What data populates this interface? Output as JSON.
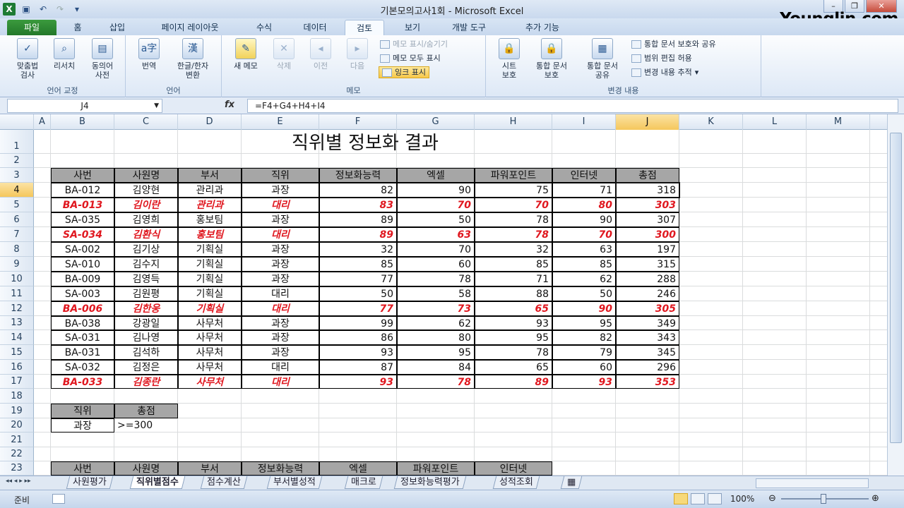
{
  "window": {
    "title": "기본모의고사1회 - Microsoft Excel",
    "brand": "Younglin.com"
  },
  "tabs": [
    "파일",
    "홈",
    "삽입",
    "페이지 레이아웃",
    "수식",
    "데이터",
    "검토",
    "보기",
    "개발 도구",
    "추가 기능"
  ],
  "active_tab": "검토",
  "ribbon": {
    "groups": {
      "lang": "언어 교정",
      "language": "언어",
      "memo": "메모",
      "changes": "변경 내용"
    },
    "spell": "맞춤법\n검사",
    "research": "리서치",
    "thesaurus": "동의어\n사전",
    "translate": "번역",
    "hanja": "한글/한자\n변환",
    "new_memo": "새 메모",
    "delete": "삭제",
    "prev": "이전",
    "next": "다음",
    "show_hide_memo": "메모 표시/숨기기",
    "show_all_memo": "메모 모두 표시",
    "ink": "잉크 표시",
    "protect_sheet": "시트\n보호",
    "protect_wb": "통합 문서\n보호",
    "share_wb": "통합 문서\n공유",
    "protect_share": "통합 문서 보호와 공유",
    "allow_edit": "범위 편집 허용",
    "track": "변경 내용 추적"
  },
  "formula_bar": {
    "name_box": "J4",
    "formula": "=F4+G4+H4+I4"
  },
  "columns": [
    "A",
    "B",
    "C",
    "D",
    "E",
    "F",
    "G",
    "H",
    "I",
    "J",
    "K",
    "L",
    "M"
  ],
  "selected_column": "J",
  "selected_row": 4,
  "rows": [
    "1",
    "2",
    "3",
    "4",
    "5",
    "6",
    "7",
    "8",
    "9",
    "10",
    "11",
    "12",
    "13",
    "14",
    "15",
    "16",
    "17",
    "18",
    "19",
    "20",
    "21",
    "22",
    "23"
  ],
  "sheet_title": "직위별 정보화 결과",
  "table_headers": [
    "사번",
    "사원명",
    "부서",
    "직위",
    "정보화능력",
    "엑셀",
    "파워포인트",
    "인터넷",
    "총점"
  ],
  "table_rows": [
    {
      "id": "BA-012",
      "name": "김양현",
      "dept": "관리과",
      "pos": "과장",
      "info": "82",
      "excel": "90",
      "ppt": "75",
      "net": "71",
      "total": "318",
      "hl": false
    },
    {
      "id": "BA-013",
      "name": "김이란",
      "dept": "관리과",
      "pos": "대리",
      "info": "83",
      "excel": "70",
      "ppt": "70",
      "net": "80",
      "total": "303",
      "hl": true
    },
    {
      "id": "SA-035",
      "name": "김영희",
      "dept": "홍보팀",
      "pos": "과장",
      "info": "89",
      "excel": "50",
      "ppt": "78",
      "net": "90",
      "total": "307",
      "hl": false
    },
    {
      "id": "SA-034",
      "name": "김환식",
      "dept": "홍보팀",
      "pos": "대리",
      "info": "89",
      "excel": "63",
      "ppt": "78",
      "net": "70",
      "total": "300",
      "hl": true
    },
    {
      "id": "SA-002",
      "name": "김기상",
      "dept": "기획실",
      "pos": "과장",
      "info": "32",
      "excel": "70",
      "ppt": "32",
      "net": "63",
      "total": "197",
      "hl": false
    },
    {
      "id": "SA-010",
      "name": "김수지",
      "dept": "기획실",
      "pos": "과장",
      "info": "85",
      "excel": "60",
      "ppt": "85",
      "net": "85",
      "total": "315",
      "hl": false
    },
    {
      "id": "BA-009",
      "name": "김영득",
      "dept": "기획실",
      "pos": "과장",
      "info": "77",
      "excel": "78",
      "ppt": "71",
      "net": "62",
      "total": "288",
      "hl": false
    },
    {
      "id": "SA-003",
      "name": "김원평",
      "dept": "기획실",
      "pos": "대리",
      "info": "50",
      "excel": "58",
      "ppt": "88",
      "net": "50",
      "total": "246",
      "hl": false
    },
    {
      "id": "BA-006",
      "name": "김한웅",
      "dept": "기획실",
      "pos": "대리",
      "info": "77",
      "excel": "73",
      "ppt": "65",
      "net": "90",
      "total": "305",
      "hl": true
    },
    {
      "id": "BA-038",
      "name": "강광일",
      "dept": "사무처",
      "pos": "과장",
      "info": "99",
      "excel": "62",
      "ppt": "93",
      "net": "95",
      "total": "349",
      "hl": false
    },
    {
      "id": "SA-031",
      "name": "김나영",
      "dept": "사무처",
      "pos": "과장",
      "info": "86",
      "excel": "80",
      "ppt": "95",
      "net": "82",
      "total": "343",
      "hl": false
    },
    {
      "id": "BA-031",
      "name": "김석하",
      "dept": "사무처",
      "pos": "과장",
      "info": "93",
      "excel": "95",
      "ppt": "78",
      "net": "79",
      "total": "345",
      "hl": false
    },
    {
      "id": "SA-032",
      "name": "김정은",
      "dept": "사무처",
      "pos": "대리",
      "info": "87",
      "excel": "84",
      "ppt": "65",
      "net": "60",
      "total": "296",
      "hl": false
    },
    {
      "id": "BA-033",
      "name": "김종란",
      "dept": "사무처",
      "pos": "대리",
      "info": "93",
      "excel": "78",
      "ppt": "89",
      "net": "93",
      "total": "353",
      "hl": true
    }
  ],
  "criteria": {
    "h1": "직위",
    "h2": "총점",
    "v1": "과장",
    "v2": ">=300"
  },
  "row23_headers": [
    "사번",
    "사원명",
    "부서",
    "정보화능력",
    "엑셀",
    "파워포인트",
    "인터넷"
  ],
  "sheet_tabs": [
    "사원평가",
    "직위별점수",
    "점수계산",
    "부서별성적",
    "매크로",
    "정보화능력평가",
    "성적조회"
  ],
  "active_sheet": "직위별점수",
  "status": {
    "ready": "준비",
    "zoom": "100%"
  }
}
